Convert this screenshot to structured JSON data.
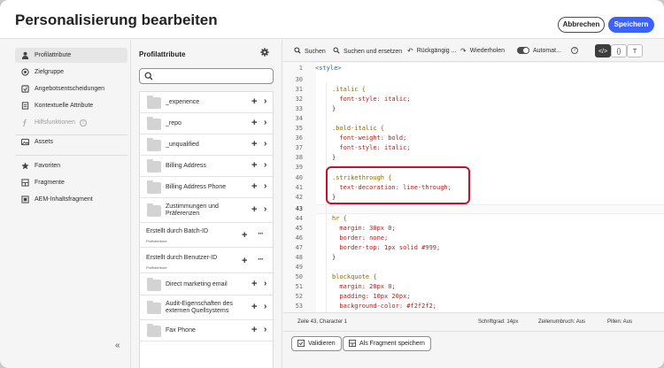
{
  "header": {
    "title": "Personalisierung bearbeiten",
    "cancel_label": "Abbrechen",
    "save_label": "Speichern"
  },
  "leftnav": {
    "items": [
      {
        "label": "Profilattribute",
        "icon": "person-icon",
        "active": true
      },
      {
        "label": "Zielgruppe",
        "icon": "target-icon"
      },
      {
        "label": "Angebotsentscheidungen",
        "icon": "decision-icon"
      },
      {
        "label": "Kontextuelle Attribute",
        "icon": "context-icon"
      },
      {
        "label": "Hilfsfunktionen",
        "icon": "function-icon",
        "disabled": true
      },
      {
        "label": "Assets",
        "icon": "image-icon"
      },
      {
        "label": "Favoriten",
        "icon": "star-icon"
      },
      {
        "label": "Fragmente",
        "icon": "fragment-icon"
      },
      {
        "label": "AEM-Inhaltsfragment",
        "icon": "aem-fragment-icon"
      }
    ],
    "collapse_glyph": "«"
  },
  "attributes": {
    "title": "Profilattribute",
    "search_value": "",
    "rows": [
      {
        "label": "_experience",
        "type": "folder"
      },
      {
        "label": "_repo",
        "type": "folder"
      },
      {
        "label": "_unqualified",
        "type": "folder"
      },
      {
        "label": "Billing Address",
        "type": "folder"
      },
      {
        "label": "Billing Address Phone",
        "type": "folder"
      },
      {
        "label": "Zustimmungen und Präferenzen",
        "type": "folder"
      },
      {
        "label": "Erstellt durch Batch-ID",
        "sub": "Profilattribute",
        "type": "field"
      },
      {
        "label": "Erstellt durch Benutzer-ID",
        "sub": "Profilattribute",
        "type": "field"
      },
      {
        "label": "Direct marketing email",
        "type": "folder"
      },
      {
        "label": "Audit-Eigenschaften des externen Quellsystems",
        "type": "folder"
      },
      {
        "label": "Fax Phone",
        "type": "folder"
      }
    ]
  },
  "toolbar": {
    "search": "Suchen",
    "replace": "Suchen und ersetzen",
    "undo": "Rückgängig ...",
    "redo": "Wiederholen",
    "auto": "Automat...",
    "help": "?",
    "view_code": "</>",
    "view_braces": "{}",
    "view_text": "T"
  },
  "code": {
    "first_line": {
      "num": "1",
      "text": "<style>"
    },
    "lines": [
      {
        "num": "30",
        "text": ""
      },
      {
        "num": "31",
        "text": ".italic {"
      },
      {
        "num": "32",
        "text": "  font-style: italic;"
      },
      {
        "num": "33",
        "text": "}"
      },
      {
        "num": "34",
        "text": ""
      },
      {
        "num": "35",
        "text": ".bold-italic {"
      },
      {
        "num": "36",
        "text": "  font-weight: bold;"
      },
      {
        "num": "37",
        "text": "  font-style: italic;"
      },
      {
        "num": "38",
        "text": "}"
      },
      {
        "num": "39",
        "text": ""
      },
      {
        "num": "40",
        "text": ".strikethrough {"
      },
      {
        "num": "41",
        "text": "  text-decoration: line-through;"
      },
      {
        "num": "42",
        "text": "}"
      },
      {
        "num": "43",
        "text": ""
      },
      {
        "num": "44",
        "text": "hr {"
      },
      {
        "num": "45",
        "text": "  margin: 30px 0;"
      },
      {
        "num": "46",
        "text": "  border: none;"
      },
      {
        "num": "47",
        "text": "  border-top: 1px solid #999;"
      },
      {
        "num": "48",
        "text": "}"
      },
      {
        "num": "49",
        "text": ""
      },
      {
        "num": "50",
        "text": "blockquote {"
      },
      {
        "num": "51",
        "text": "  margin: 20px 0;"
      },
      {
        "num": "52",
        "text": "  padding: 10px 20px;"
      },
      {
        "num": "53",
        "text": "  background-color: #f2f2f2;"
      }
    ]
  },
  "status": {
    "position": "Zeile 43, Character 1",
    "font_size": "Schriftgrad: 14px",
    "wrap": "Zeilenumbruch: Aus",
    "pills": "Pillen: Aus"
  },
  "bottom": {
    "validate": "Validieren",
    "save_fragment": "Als Fragment speichern"
  },
  "colors": {
    "accent": "#3b63fb",
    "highlight": "#c8102e"
  }
}
